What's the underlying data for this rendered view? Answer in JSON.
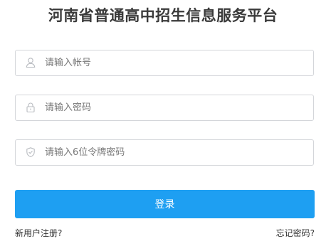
{
  "title": "河南省普通高中招生信息服务平台",
  "form": {
    "account": {
      "placeholder": "请输入帐号",
      "icon": "user-icon"
    },
    "password": {
      "placeholder": "请输入密码",
      "icon": "lock-icon"
    },
    "pin": {
      "placeholder": "请输入6位令牌密码",
      "icon": "shield-icon"
    }
  },
  "login_label": "登录",
  "links": {
    "register": "新用户注册?",
    "forgot": "忘记密码?"
  },
  "colors": {
    "accent": "#1e9ff2",
    "border": "#d4d6da",
    "title": "#3a3a3a"
  }
}
